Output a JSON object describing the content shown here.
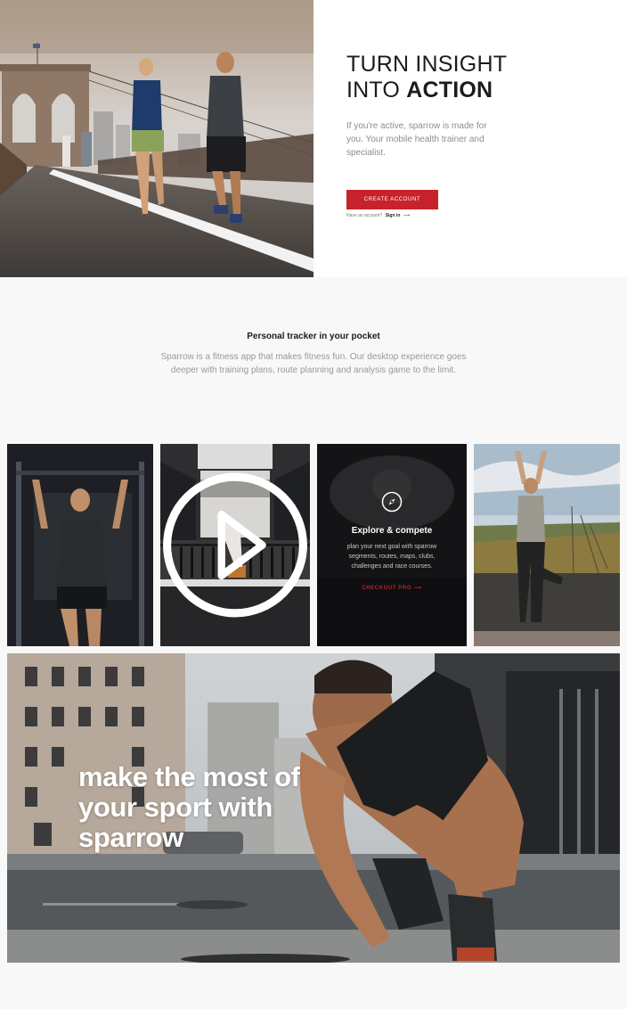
{
  "hero": {
    "title_light": "TURN INSIGHT INTO",
    "title_line1": "TURN INSIGHT",
    "title_line2_light": "INTO ",
    "title_line2_bold": "ACTION",
    "description": "If you're active, sparrow is made for you. Your mobile health trainer and specialist.",
    "cta_label": "CREATE ACCOUNT",
    "signin_prompt": "Have an account?",
    "signin_label": "Sign in",
    "signin_arrow": "⟶",
    "accent_color": "#c8232c"
  },
  "tracker": {
    "title": "Personal tracker in your pocket",
    "description": "Sparrow is a fitness app that makes fitness fun. Our desktop experience goes deeper with training plans, route planning and analysis game to the limit."
  },
  "grid": {
    "explore": {
      "icon": "compass-icon",
      "title": "Explore & compete",
      "description": "plan your next goal with sparrow segments, routes, maps, clubs, challenges and race courses.",
      "link_label": "CHECKOUT PRO",
      "link_arrow": "⟶"
    },
    "video_icon": "play-icon",
    "headline": "make the most of your sport with sparrow"
  }
}
